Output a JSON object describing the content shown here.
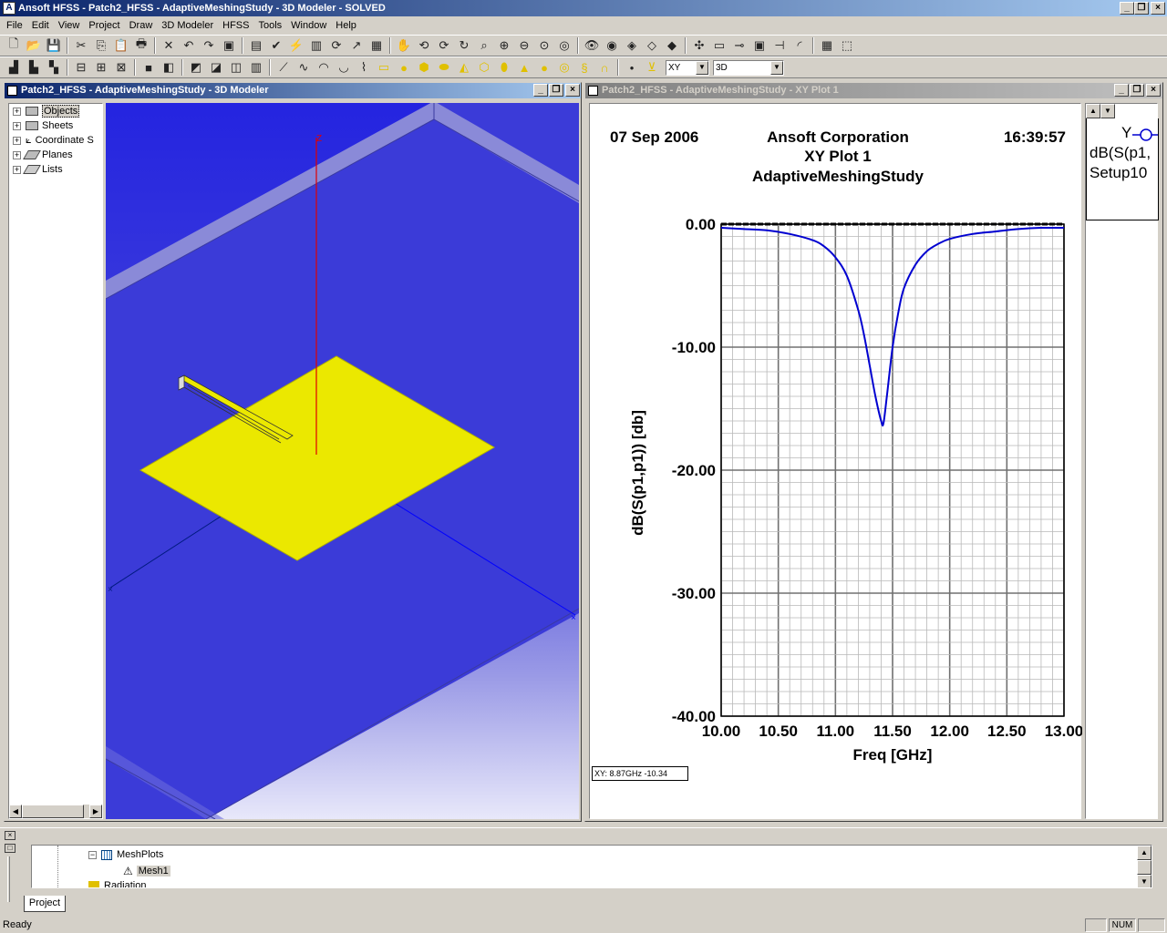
{
  "app": {
    "title": "Ansoft HFSS - Patch2_HFSS - AdaptiveMeshingStudy - 3D Modeler - SOLVED"
  },
  "menu": [
    "File",
    "Edit",
    "View",
    "Project",
    "Draw",
    "3D Modeler",
    "HFSS",
    "Tools",
    "Window",
    "Help"
  ],
  "toolbar2": {
    "plane_combo": "XY",
    "mode_combo": "3D"
  },
  "modeler_window": {
    "title": "Patch2_HFSS - AdaptiveMeshingStudy - 3D Modeler",
    "tree": [
      "Objects",
      "Sheets",
      "Coordinate S",
      "Planes",
      "Lists"
    ],
    "axis_label": "Z"
  },
  "plot_window": {
    "title": "Patch2_HFSS - AdaptiveMeshingStudy - XY Plot 1",
    "date": "07 Sep 2006",
    "company": "Ansoft Corporation",
    "plot_name": "XY Plot 1",
    "design": "AdaptiveMeshingStudy",
    "time": "16:39:57",
    "readout": "XY: 8.87GHz -10.34",
    "legend": {
      "line1": "Y",
      "line2": "dB(S(p1,",
      "line3": "Setup10"
    }
  },
  "chart_data": {
    "type": "line",
    "xlabel": "Freq [GHz]",
    "ylabel": "dB(S(p1,p1)) [db]",
    "xlim": [
      10.0,
      13.0
    ],
    "ylim": [
      -40.0,
      0.0
    ],
    "xticks": [
      "10.00",
      "10.50",
      "11.00",
      "11.50",
      "12.00",
      "12.50",
      "13.00"
    ],
    "yticks": [
      "0.00",
      "-10.00",
      "-20.00",
      "-30.00",
      "-40.00"
    ],
    "grid": true,
    "series": [
      {
        "color": "#0000d0",
        "x": [
          10.0,
          10.2,
          10.4,
          10.6,
          10.8,
          10.9,
          11.0,
          11.1,
          11.2,
          11.25,
          11.3,
          11.35,
          11.4,
          11.42,
          11.45,
          11.5,
          11.55,
          11.6,
          11.7,
          11.8,
          11.9,
          12.0,
          12.2,
          12.4,
          12.6,
          12.8,
          13.0
        ],
        "y": [
          -0.3,
          -0.4,
          -0.5,
          -0.8,
          -1.3,
          -1.8,
          -2.7,
          -4.2,
          -7.0,
          -9.0,
          -11.5,
          -14.0,
          -16.0,
          -16.2,
          -14.0,
          -10.0,
          -7.2,
          -5.2,
          -3.3,
          -2.2,
          -1.6,
          -1.2,
          -0.8,
          -0.6,
          -0.4,
          -0.3,
          -0.3
        ]
      }
    ]
  },
  "project_panel": {
    "items": [
      "MeshPlots",
      "Mesh1",
      "Radiation"
    ],
    "tab": "Project"
  },
  "status": {
    "text": "Ready",
    "num": "NUM"
  }
}
